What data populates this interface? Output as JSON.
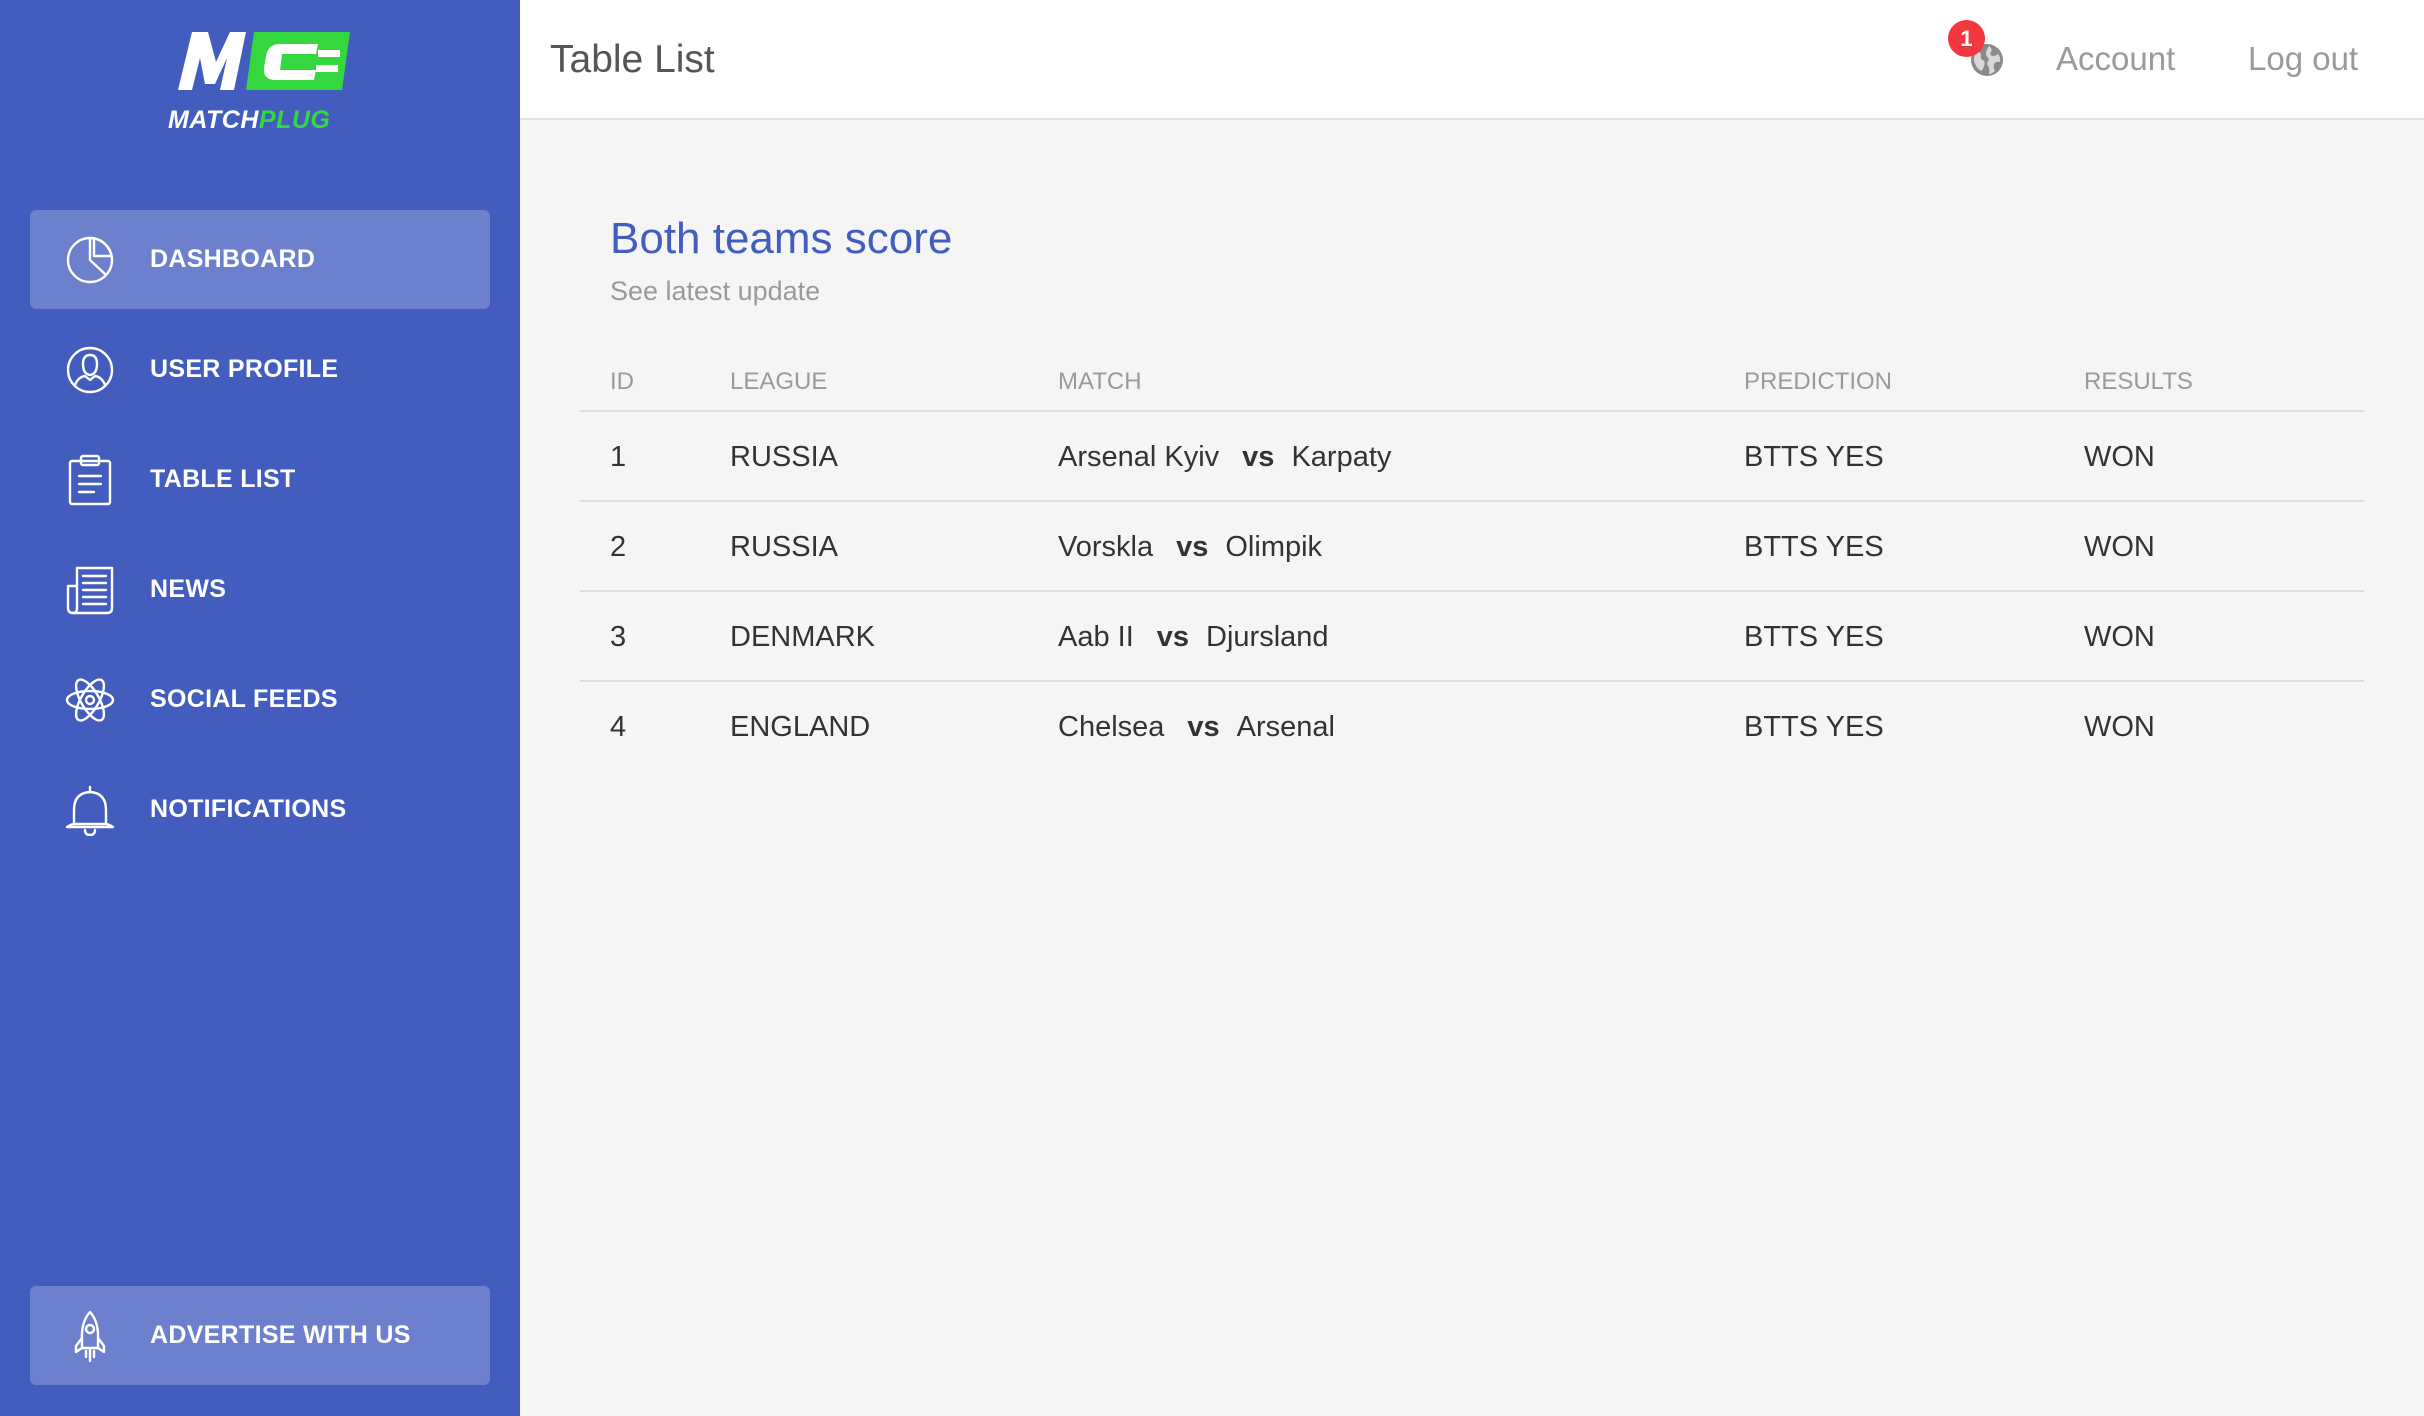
{
  "app": {
    "logo_primary": "MATCH",
    "logo_secondary": "PLUG",
    "brand_color": "#435dbf",
    "accent_color": "#35d73e"
  },
  "sidebar": {
    "items": [
      {
        "label": "DASHBOARD",
        "icon": "pie-chart-icon",
        "active": true
      },
      {
        "label": "USER PROFILE",
        "icon": "user-icon",
        "active": false
      },
      {
        "label": "TABLE LIST",
        "icon": "clipboard-icon",
        "active": false
      },
      {
        "label": "NEWS",
        "icon": "newspaper-icon",
        "active": false
      },
      {
        "label": "SOCIAL FEEDS",
        "icon": "atom-icon",
        "active": false
      },
      {
        "label": "NOTIFICATIONS",
        "icon": "bell-icon",
        "active": false
      }
    ],
    "advertise": {
      "label": "ADVERTISE WITH US",
      "icon": "rocket-icon"
    }
  },
  "header": {
    "title": "Table List",
    "notification_count": "1",
    "notification_icon": "globe-icon",
    "account_label": "Account",
    "logout_label": "Log out"
  },
  "main": {
    "title": "Both teams score",
    "subtitle": "See latest update",
    "columns": [
      "ID",
      "LEAGUE",
      "MATCH",
      "PREDICTION",
      "RESULTS"
    ],
    "vs_label": "vs",
    "rows": [
      {
        "id": "1",
        "league": "RUSSIA",
        "home": "Arsenal Kyiv",
        "away": "Karpaty",
        "prediction": "BTTS YES",
        "result": "WON"
      },
      {
        "id": "2",
        "league": "RUSSIA",
        "home": "Vorskla",
        "away": "Olimpik",
        "prediction": "BTTS YES",
        "result": "WON"
      },
      {
        "id": "3",
        "league": "DENMARK",
        "home": "Aab II",
        "away": "Djursland",
        "prediction": "BTTS YES",
        "result": "WON"
      },
      {
        "id": "4",
        "league": "ENGLAND",
        "home": "Chelsea",
        "away": "Arsenal",
        "prediction": "BTTS YES",
        "result": "WON"
      }
    ]
  }
}
